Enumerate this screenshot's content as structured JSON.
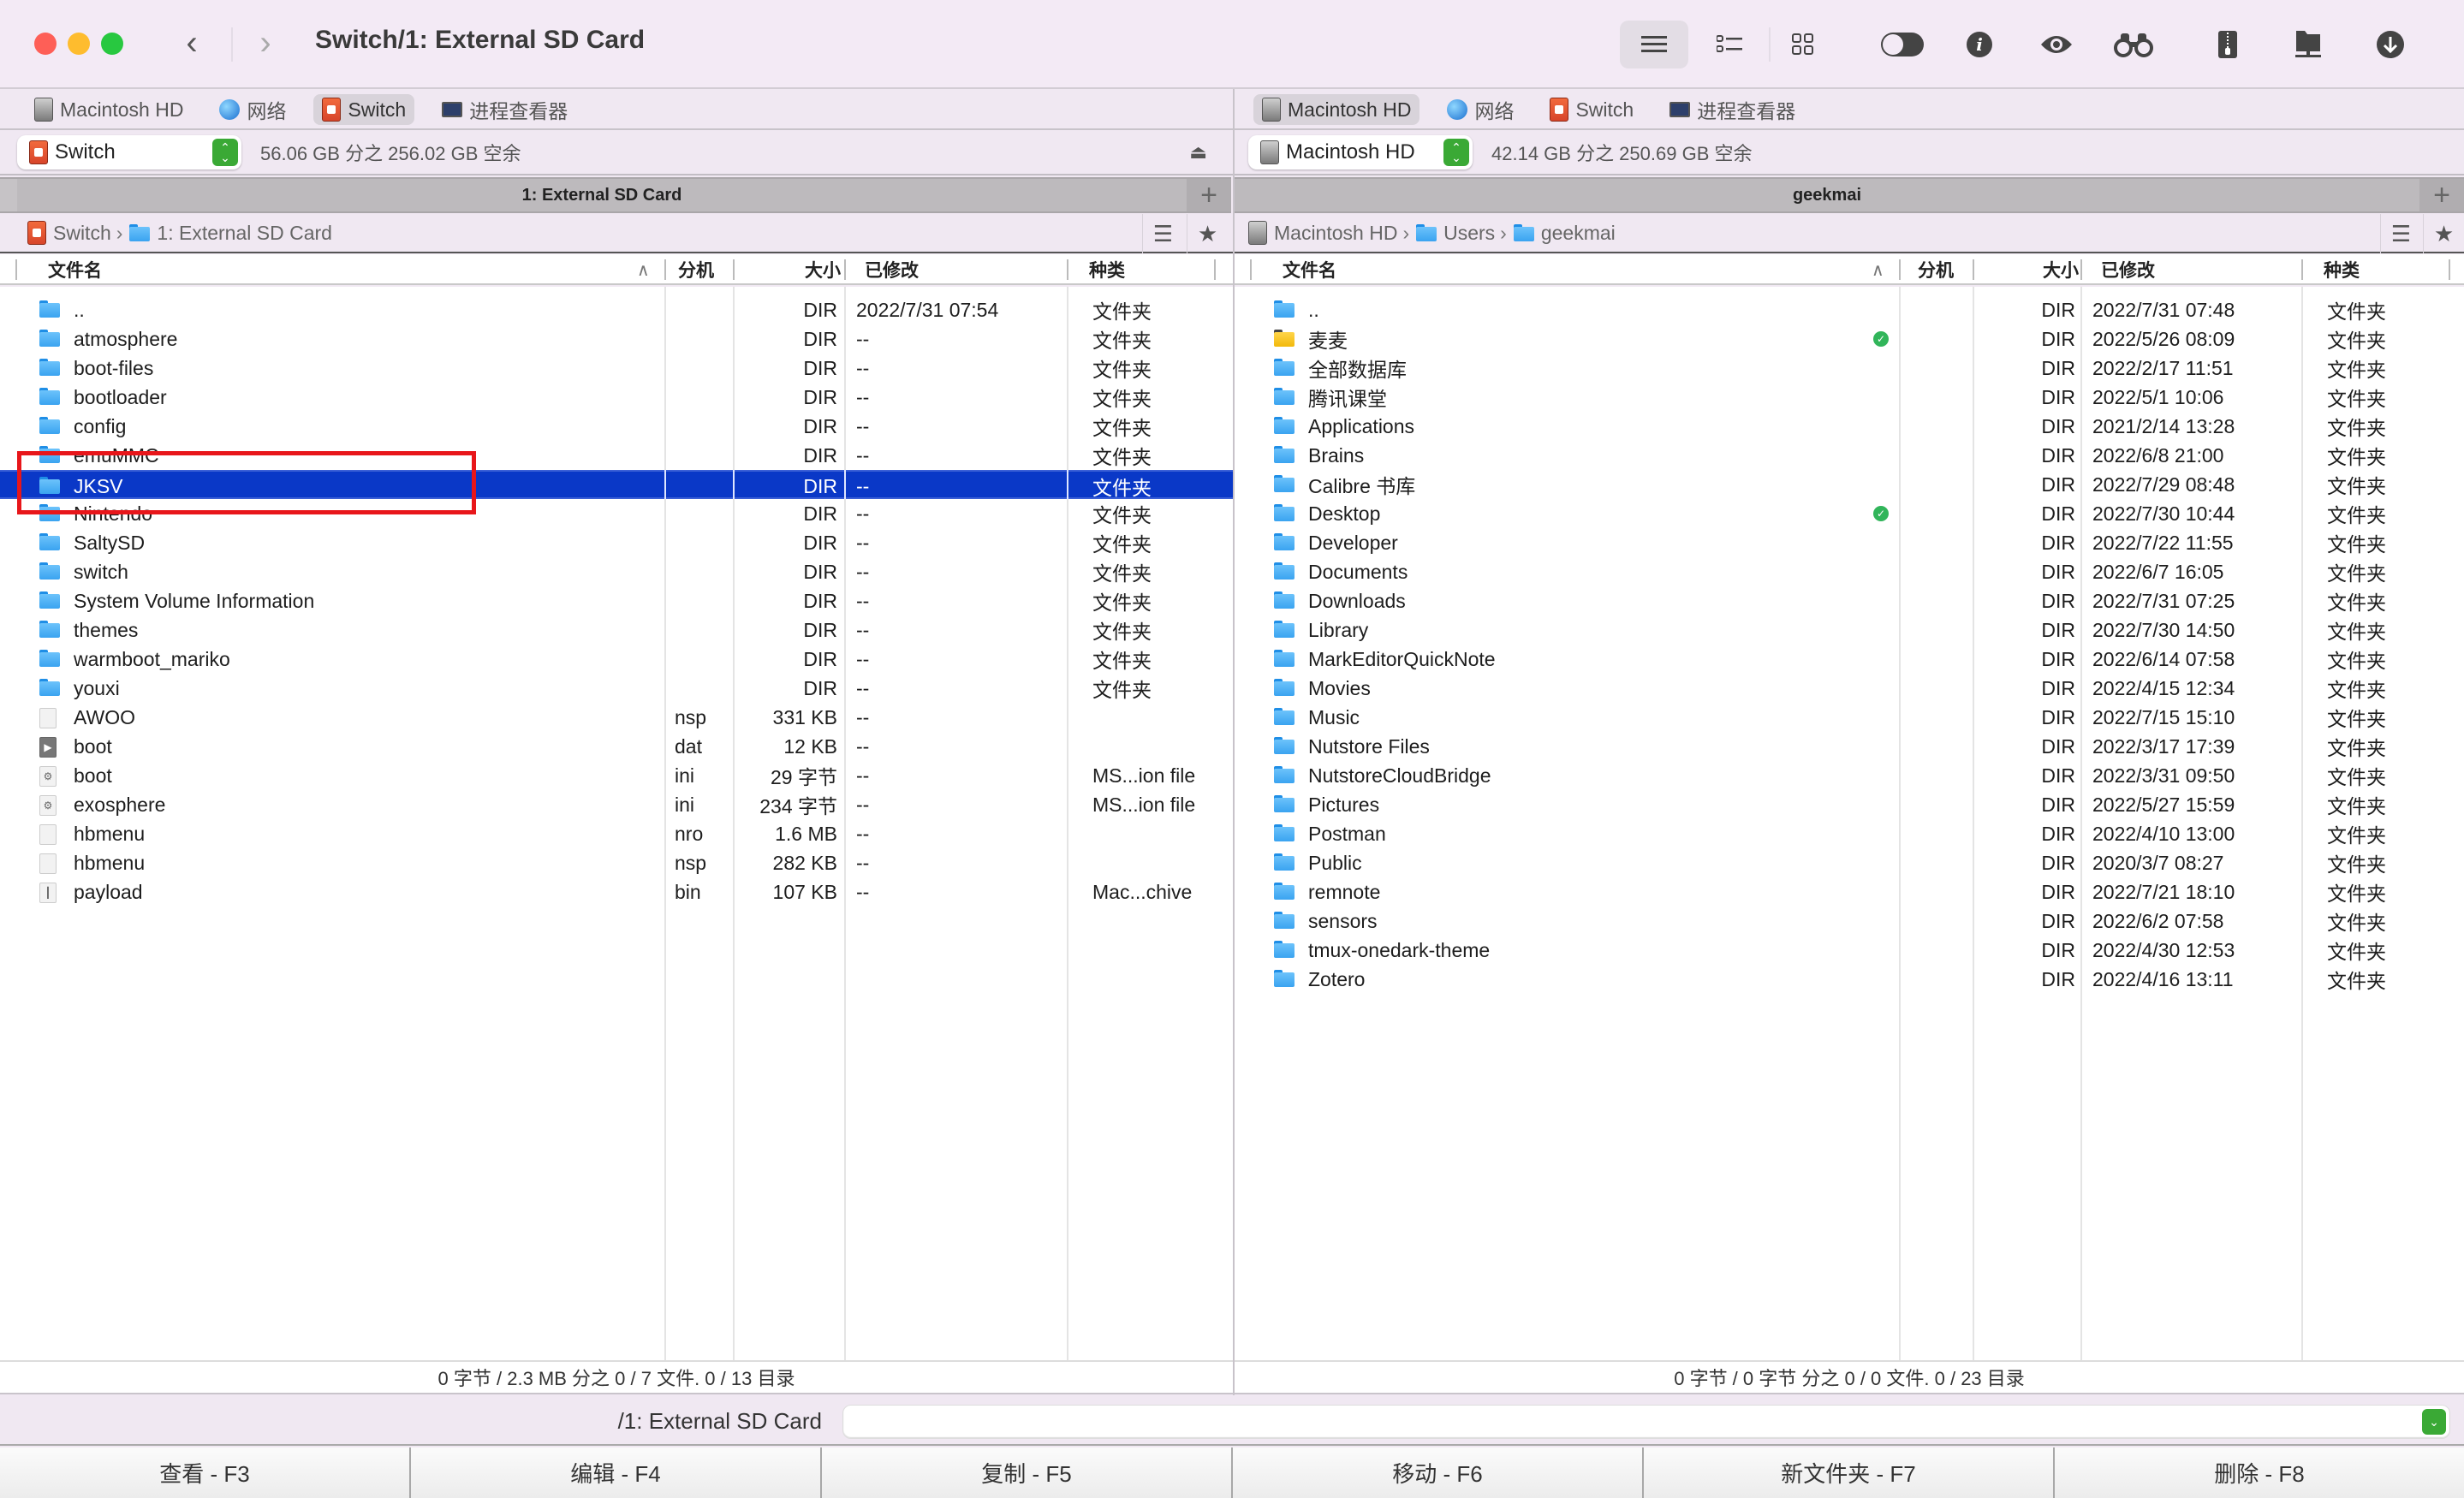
{
  "window": {
    "title": "Switch/1: External SD Card",
    "nav_back_icon": "chevron-left-icon",
    "nav_forward_icon": "chevron-right-icon"
  },
  "toolbar": {
    "buttons": [
      {
        "name": "list-view",
        "icon": "list-icon",
        "active": true
      },
      {
        "name": "detail-list-view",
        "icon": "detail-list-icon",
        "active": false
      },
      {
        "name": "grid-view",
        "icon": "grid-icon",
        "active": false
      },
      {
        "name": "toggle-hidden",
        "icon": "toggle-icon",
        "active": false
      },
      {
        "name": "info",
        "icon": "info-icon",
        "active": false
      },
      {
        "name": "preview",
        "icon": "eye-icon",
        "active": false
      },
      {
        "name": "search",
        "icon": "binoculars-icon",
        "active": false
      },
      {
        "name": "archive",
        "icon": "zip-icon",
        "active": false
      },
      {
        "name": "network-share",
        "icon": "network-folder-icon",
        "active": false
      },
      {
        "name": "download",
        "icon": "download-icon",
        "active": false
      }
    ]
  },
  "left": {
    "volume_tabs": [
      {
        "label": "Macintosh HD",
        "icon": "hard-drive-icon",
        "active": false
      },
      {
        "label": "网络",
        "icon": "network-globe-icon",
        "active": false
      },
      {
        "label": "Switch",
        "icon": "switch-drive-icon",
        "active": true
      },
      {
        "label": "进程查看器",
        "icon": "process-viewer-icon",
        "active": false
      }
    ],
    "drive": {
      "name": "Switch",
      "free_space": "56.06 GB 分之 256.02 GB 空余"
    },
    "pane_title": "1: External SD Card",
    "breadcrumb": [
      {
        "label": "Switch",
        "icon": "switch-drive-icon"
      },
      {
        "label": "1: External SD Card",
        "icon": "folder-icon"
      }
    ],
    "columns": {
      "name": "文件名",
      "ext": "分机",
      "size": "大小",
      "modified": "已修改",
      "kind": "种类"
    },
    "rows": [
      {
        "name": "..",
        "ext": "",
        "size": "DIR",
        "modified": "2022/7/31 07:54",
        "kind": "文件夹",
        "icon": "folder"
      },
      {
        "name": "atmosphere",
        "ext": "",
        "size": "DIR",
        "modified": "--",
        "kind": "文件夹",
        "icon": "folder"
      },
      {
        "name": "boot-files",
        "ext": "",
        "size": "DIR",
        "modified": "--",
        "kind": "文件夹",
        "icon": "folder"
      },
      {
        "name": "bootloader",
        "ext": "",
        "size": "DIR",
        "modified": "--",
        "kind": "文件夹",
        "icon": "folder"
      },
      {
        "name": "config",
        "ext": "",
        "size": "DIR",
        "modified": "--",
        "kind": "文件夹",
        "icon": "folder"
      },
      {
        "name": "emuMMC",
        "ext": "",
        "size": "DIR",
        "modified": "--",
        "kind": "文件夹",
        "icon": "folder"
      },
      {
        "name": "JKSV",
        "ext": "",
        "size": "DIR",
        "modified": "--",
        "kind": "文件夹",
        "icon": "folder",
        "selected": true
      },
      {
        "name": "Nintendo",
        "ext": "",
        "size": "DIR",
        "modified": "--",
        "kind": "文件夹",
        "icon": "folder"
      },
      {
        "name": "SaltySD",
        "ext": "",
        "size": "DIR",
        "modified": "--",
        "kind": "文件夹",
        "icon": "folder"
      },
      {
        "name": "switch",
        "ext": "",
        "size": "DIR",
        "modified": "--",
        "kind": "文件夹",
        "icon": "folder"
      },
      {
        "name": "System Volume Information",
        "ext": "",
        "size": "DIR",
        "modified": "--",
        "kind": "文件夹",
        "icon": "folder"
      },
      {
        "name": "themes",
        "ext": "",
        "size": "DIR",
        "modified": "--",
        "kind": "文件夹",
        "icon": "folder"
      },
      {
        "name": "warmboot_mariko",
        "ext": "",
        "size": "DIR",
        "modified": "--",
        "kind": "文件夹",
        "icon": "folder"
      },
      {
        "name": "youxi",
        "ext": "",
        "size": "DIR",
        "modified": "--",
        "kind": "文件夹",
        "icon": "folder"
      },
      {
        "name": "AWOO",
        "ext": "nsp",
        "size": "331 KB",
        "modified": "--",
        "kind": "",
        "icon": "document"
      },
      {
        "name": "boot",
        "ext": "dat",
        "size": "12 KB",
        "modified": "--",
        "kind": "",
        "icon": "video-document"
      },
      {
        "name": "boot",
        "ext": "ini",
        "size": "29 字节",
        "modified": "--",
        "kind": "MS...ion file",
        "icon": "settings-document"
      },
      {
        "name": "exosphere",
        "ext": "ini",
        "size": "234 字节",
        "modified": "--",
        "kind": "MS...ion file",
        "icon": "settings-document"
      },
      {
        "name": "hbmenu",
        "ext": "nro",
        "size": "1.6 MB",
        "modified": "--",
        "kind": "",
        "icon": "document"
      },
      {
        "name": "hbmenu",
        "ext": "nsp",
        "size": "282 KB",
        "modified": "--",
        "kind": "",
        "icon": "document"
      },
      {
        "name": "payload",
        "ext": "bin",
        "size": "107 KB",
        "modified": "--",
        "kind": "Mac...chive",
        "icon": "archive-document"
      }
    ],
    "status": "0 字节 / 2.3 MB 分之 0 / 7 文件. 0 / 13 目录"
  },
  "right": {
    "volume_tabs": [
      {
        "label": "Macintosh HD",
        "icon": "hard-drive-icon",
        "active": true
      },
      {
        "label": "网络",
        "icon": "network-globe-icon",
        "active": false
      },
      {
        "label": "Switch",
        "icon": "switch-drive-icon",
        "active": false
      },
      {
        "label": "进程查看器",
        "icon": "process-viewer-icon",
        "active": false
      }
    ],
    "drive": {
      "name": "Macintosh HD",
      "free_space": "42.14 GB 分之 250.69 GB 空余"
    },
    "pane_title": "geekmai",
    "breadcrumb": [
      {
        "label": "Macintosh HD",
        "icon": "hard-drive-icon"
      },
      {
        "label": "Users",
        "icon": "users-folder-icon"
      },
      {
        "label": "geekmai",
        "icon": "home-folder-icon"
      }
    ],
    "columns": {
      "name": "文件名",
      "ext": "分机",
      "size": "大小",
      "modified": "已修改",
      "kind": "种类"
    },
    "rows": [
      {
        "name": "..",
        "ext": "",
        "size": "DIR",
        "modified": "2022/7/31 07:48",
        "kind": "文件夹",
        "icon": "folder"
      },
      {
        "name": "麦麦",
        "ext": "",
        "size": "DIR",
        "modified": "2022/5/26 08:09",
        "kind": "文件夹",
        "icon": "folder-yellow",
        "synced": true
      },
      {
        "name": "全部数据库",
        "ext": "",
        "size": "DIR",
        "modified": "2022/2/17 11:51",
        "kind": "文件夹",
        "icon": "folder"
      },
      {
        "name": "腾讯课堂",
        "ext": "",
        "size": "DIR",
        "modified": "2022/5/1 10:06",
        "kind": "文件夹",
        "icon": "folder"
      },
      {
        "name": "Applications",
        "ext": "",
        "size": "DIR",
        "modified": "2021/2/14 13:28",
        "kind": "文件夹",
        "icon": "folder"
      },
      {
        "name": "Brains",
        "ext": "",
        "size": "DIR",
        "modified": "2022/6/8 21:00",
        "kind": "文件夹",
        "icon": "folder"
      },
      {
        "name": "Calibre 书库",
        "ext": "",
        "size": "DIR",
        "modified": "2022/7/29 08:48",
        "kind": "文件夹",
        "icon": "folder"
      },
      {
        "name": "Desktop",
        "ext": "",
        "size": "DIR",
        "modified": "2022/7/30 10:44",
        "kind": "文件夹",
        "icon": "folder",
        "synced": true
      },
      {
        "name": "Developer",
        "ext": "",
        "size": "DIR",
        "modified": "2022/7/22 11:55",
        "kind": "文件夹",
        "icon": "folder"
      },
      {
        "name": "Documents",
        "ext": "",
        "size": "DIR",
        "modified": "2022/6/7 16:05",
        "kind": "文件夹",
        "icon": "folder"
      },
      {
        "name": "Downloads",
        "ext": "",
        "size": "DIR",
        "modified": "2022/7/31 07:25",
        "kind": "文件夹",
        "icon": "folder"
      },
      {
        "name": "Library",
        "ext": "",
        "size": "DIR",
        "modified": "2022/7/30 14:50",
        "kind": "文件夹",
        "icon": "folder"
      },
      {
        "name": "MarkEditorQuickNote",
        "ext": "",
        "size": "DIR",
        "modified": "2022/6/14 07:58",
        "kind": "文件夹",
        "icon": "folder"
      },
      {
        "name": "Movies",
        "ext": "",
        "size": "DIR",
        "modified": "2022/4/15 12:34",
        "kind": "文件夹",
        "icon": "folder"
      },
      {
        "name": "Music",
        "ext": "",
        "size": "DIR",
        "modified": "2022/7/15 15:10",
        "kind": "文件夹",
        "icon": "folder"
      },
      {
        "name": "Nutstore Files",
        "ext": "",
        "size": "DIR",
        "modified": "2022/3/17 17:39",
        "kind": "文件夹",
        "icon": "folder"
      },
      {
        "name": "NutstoreCloudBridge",
        "ext": "",
        "size": "DIR",
        "modified": "2022/3/31 09:50",
        "kind": "文件夹",
        "icon": "folder"
      },
      {
        "name": "Pictures",
        "ext": "",
        "size": "DIR",
        "modified": "2022/5/27 15:59",
        "kind": "文件夹",
        "icon": "folder"
      },
      {
        "name": "Postman",
        "ext": "",
        "size": "DIR",
        "modified": "2022/4/10 13:00",
        "kind": "文件夹",
        "icon": "folder"
      },
      {
        "name": "Public",
        "ext": "",
        "size": "DIR",
        "modified": "2020/3/7 08:27",
        "kind": "文件夹",
        "icon": "folder"
      },
      {
        "name": "remnote",
        "ext": "",
        "size": "DIR",
        "modified": "2022/7/21 18:10",
        "kind": "文件夹",
        "icon": "folder"
      },
      {
        "name": "sensors",
        "ext": "",
        "size": "DIR",
        "modified": "2022/6/2 07:58",
        "kind": "文件夹",
        "icon": "folder"
      },
      {
        "name": "tmux-onedark-theme",
        "ext": "",
        "size": "DIR",
        "modified": "2022/4/30 12:53",
        "kind": "文件夹",
        "icon": "folder"
      },
      {
        "name": "Zotero",
        "ext": "",
        "size": "DIR",
        "modified": "2022/4/16 13:11",
        "kind": "文件夹",
        "icon": "folder"
      }
    ],
    "status": "0 字节 / 0 字节 分之 0 / 0 文件. 0 / 23 目录"
  },
  "command_line": {
    "path_label": "/1: External SD Card",
    "value": ""
  },
  "function_keys": [
    {
      "label": "查看 - F3"
    },
    {
      "label": "编辑 - F4"
    },
    {
      "label": "复制 - F5"
    },
    {
      "label": "移动 - F6"
    },
    {
      "label": "新文件夹 - F7"
    },
    {
      "label": "删除 - F8"
    }
  ],
  "colors": {
    "selection": "#0a38c7",
    "accent_green": "#3aa935",
    "annotation_red": "#e8161a"
  }
}
